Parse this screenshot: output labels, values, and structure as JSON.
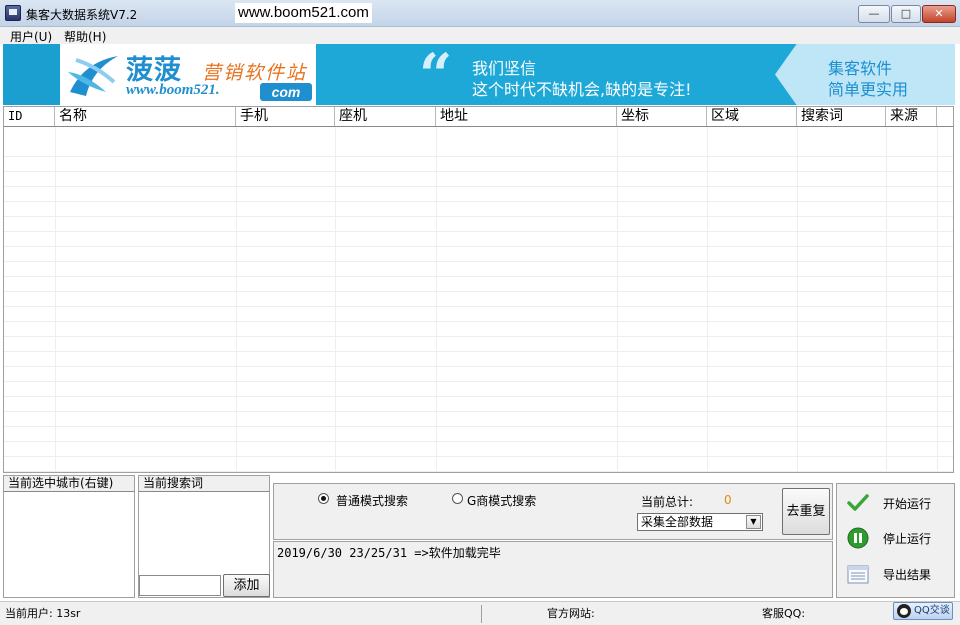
{
  "window": {
    "title": "集客大数据系统V7.2",
    "url": "www.boom521.com",
    "minimize_glyph": "—",
    "maximize_glyph": "□",
    "close_glyph": "✕"
  },
  "menu": {
    "items": [
      {
        "label": "用户(U)"
      },
      {
        "label": "帮助(H)"
      }
    ]
  },
  "banner": {
    "logo_cn": "菠菠",
    "logo_sub": "营销软件站",
    "logo_www": "www.boom521.",
    "logo_com": "com",
    "quote": "“",
    "slogan_line1": "我们坚信",
    "slogan_line2": "这个时代不缺机会,缺的是专注!",
    "tag_line1": "集客软件",
    "tag_line2": "简单更实用",
    "colors": {
      "bg": "#1ea8d8",
      "logo_blue": "#1f8fd0",
      "logo_orange": "#e8721d",
      "tag_bg": "#bfe6f7"
    }
  },
  "table": {
    "columns": [
      "ID",
      "名称",
      "手机",
      "座机",
      "地址",
      "坐标",
      "区域",
      "搜索词",
      "来源"
    ],
    "rows": []
  },
  "city_panel": {
    "header": "当前选中城市(右键)"
  },
  "keyword_panel": {
    "header": "当前搜索词",
    "input_value": "",
    "add_label": "添加"
  },
  "search_modes": {
    "normal": "普通模式搜索",
    "gshop": "G商模式搜索",
    "selected": "normal"
  },
  "total": {
    "label": "当前总计:",
    "value": "0"
  },
  "collect_select": {
    "selected": "采集全部数据"
  },
  "dedup_label": "去重复",
  "log_line": "2019/6/30 23/25/31 =>软件加载完毕",
  "actions": [
    {
      "label": "开始运行",
      "icon": "checkmark-icon"
    },
    {
      "label": "停止运行",
      "icon": "pause-icon"
    },
    {
      "label": "导出结果",
      "icon": "list-icon"
    }
  ],
  "status": {
    "current_user": "当前用户: 13sr",
    "website": "官方网站:",
    "qq": "客服QQ:",
    "qq_button": "QQ交谈"
  }
}
